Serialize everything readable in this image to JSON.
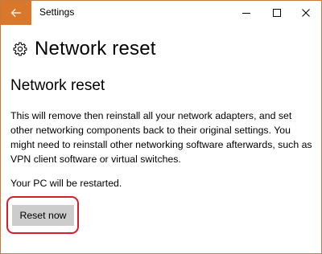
{
  "window": {
    "title": "Settings",
    "accent_color": "#d9782b",
    "controls": {
      "back_icon": "back-arrow-icon",
      "minimize_icon": "minimize-icon",
      "maximize_icon": "maximize-icon",
      "close_icon": "close-icon"
    }
  },
  "header": {
    "icon": "gear-icon",
    "title": "Network reset"
  },
  "content": {
    "section_title": "Network reset",
    "description": "This will remove then reinstall all your network adapters, and set other networking components back to their original settings. You might need to reinstall other networking software afterwards, such as VPN client software or virtual switches.",
    "restart_note": "Your PC will be restarted.",
    "reset_button_label": "Reset now",
    "highlight_color": "#d81e2a"
  }
}
